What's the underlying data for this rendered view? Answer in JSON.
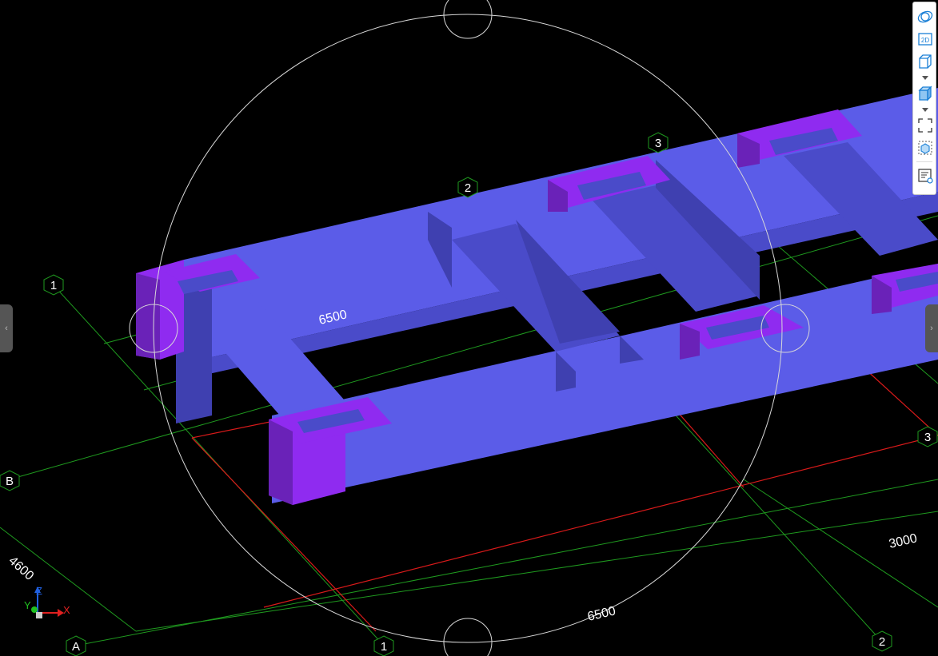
{
  "colors": {
    "background": "#000000",
    "grid_line": "#1f9a1f",
    "grid_red": "#d81a1a",
    "wall_top": "#5b5ce8",
    "wall_side": "#4a4bc9",
    "wall_shade": "#3f40b0",
    "cut_face": "#8f2bf0",
    "cut_face_dark": "#6a22b8",
    "orbit_circle": "#d8d8d8"
  },
  "grid_labels": {
    "top_2": "2",
    "top_3": "3",
    "left_1": "1",
    "left_B": "B",
    "bottom_A": "A",
    "bottom_1": "1",
    "bottom_2": "2",
    "right_3": "3"
  },
  "dimensions": {
    "d_4600": "4600",
    "d_6500_bottom": "6500",
    "d_6500_inner": "6500",
    "d_3000": "3000"
  },
  "axes": {
    "x": "X",
    "y": "Y",
    "z": "Z"
  },
  "toolbar": {
    "icons": [
      "orbit-icon",
      "view-2d-icon",
      "wireframe-cube-icon",
      "chevron-down-icon",
      "shaded-cube-icon",
      "chevron-down-icon",
      "zoom-extents-icon",
      "view-cube-icon",
      "properties-icon"
    ],
    "view_2d_label": "2D"
  },
  "side_tabs": {
    "left_arrow": "‹",
    "right_arrow": "›"
  }
}
